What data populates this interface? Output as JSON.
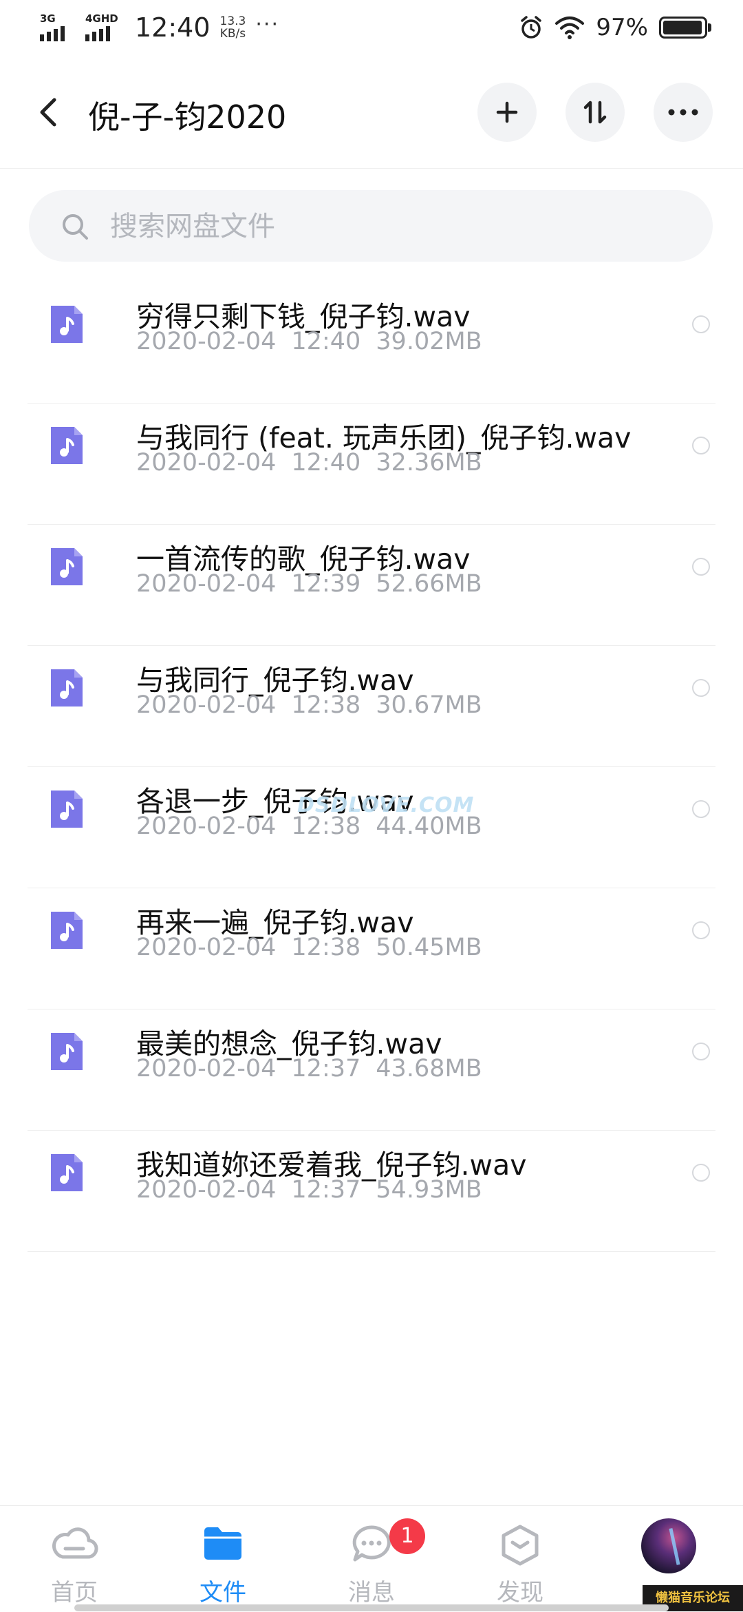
{
  "status_bar": {
    "signal_1": "3G",
    "signal_2": "4GHD",
    "time": "12:40",
    "speed_value": "13.3",
    "speed_unit": "KB/s",
    "more": "···",
    "battery": "97%"
  },
  "header": {
    "title": "倪-子-钧2020",
    "back_icon": "chevron-left-icon",
    "add_icon": "plus-icon",
    "sort_icon": "sort-arrows-icon",
    "more_icon": "more-horizontal-icon"
  },
  "search": {
    "placeholder": "搜索网盘文件",
    "value": ""
  },
  "files": [
    {
      "name": "穷得只剩下钱_倪子钧.wav",
      "date": "2020-02-04",
      "time": "12:40",
      "size": "39.02MB"
    },
    {
      "name": "与我同行 (feat. 玩声乐团)_倪子钧.wav",
      "date": "2020-02-04",
      "time": "12:40",
      "size": "32.36MB"
    },
    {
      "name": "一首流传的歌_倪子钧.wav",
      "date": "2020-02-04",
      "time": "12:39",
      "size": "52.66MB"
    },
    {
      "name": "与我同行_倪子钧.wav",
      "date": "2020-02-04",
      "time": "12:38",
      "size": "30.67MB"
    },
    {
      "name": "各退一步_倪子钧.wav",
      "date": "2020-02-04",
      "time": "12:38",
      "size": "44.40MB"
    },
    {
      "name": "再来一遍_倪子钧.wav",
      "date": "2020-02-04",
      "time": "12:38",
      "size": "50.45MB"
    },
    {
      "name": "最美的想念_倪子钧.wav",
      "date": "2020-02-04",
      "time": "12:37",
      "size": "43.68MB"
    },
    {
      "name": "我知道妳还爱着我_倪子钧.wav",
      "date": "2020-02-04",
      "time": "12:37",
      "size": "54.93MB"
    }
  ],
  "watermark": "DSDLOVE.COM",
  "bottom_nav": {
    "home": "首页",
    "files": "文件",
    "messages": "消息",
    "messages_badge": "1",
    "discover": "发现",
    "active": "files"
  },
  "forum_tag": "懒猫音乐论坛",
  "colors": {
    "accent": "#1e8cf6",
    "file_icon": "#7b76e8",
    "badge": "#f43a48",
    "meta_text": "#a5a8ae"
  }
}
